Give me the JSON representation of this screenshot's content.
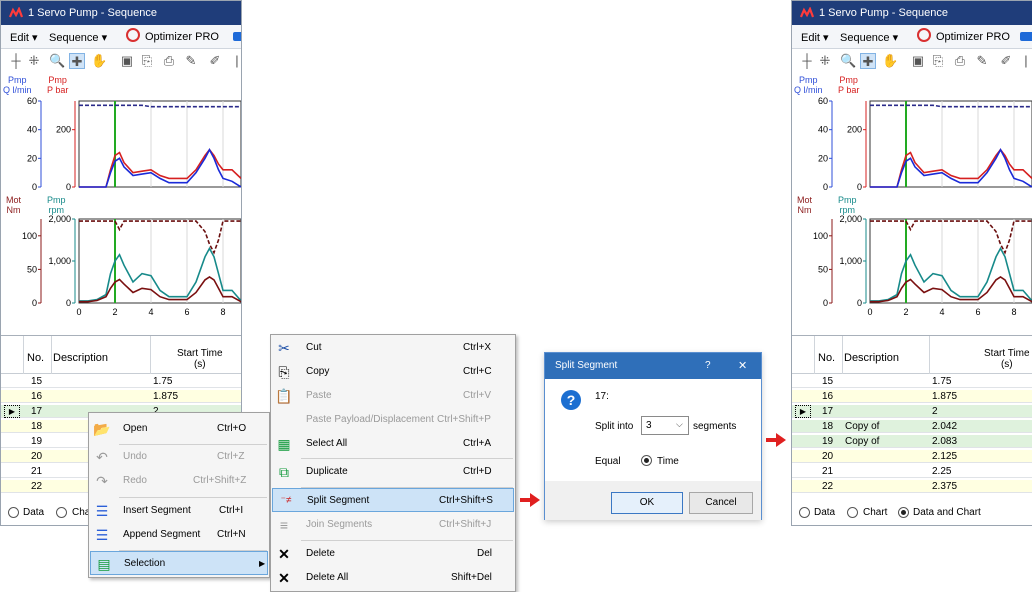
{
  "window": {
    "title": "1 Servo Pump - Sequence",
    "menu": {
      "edit": "Edit ▾",
      "sequence": "Sequence ▾",
      "optimizer": "Optimizer PRO"
    }
  },
  "chart_data": [
    {
      "type": "line",
      "title": "",
      "axes": [
        {
          "label": "Pmp\nQ l/min",
          "color": "#2f4fd8",
          "ticks": [
            "60",
            "40",
            "20",
            "0"
          ],
          "ylim": [
            0,
            60
          ]
        },
        {
          "label": "Pmp\nP bar",
          "color": "#d62020",
          "ticks": [
            "200",
            "0"
          ],
          "ylim": [
            0,
            300
          ]
        }
      ],
      "x": [
        0,
        0.5,
        1.0,
        1.5,
        1.75,
        2.0,
        2.25,
        2.5,
        3.0,
        3.5,
        4.0,
        4.5,
        5.0,
        5.5,
        6.0,
        6.5,
        7.0,
        7.25,
        7.5,
        7.75,
        8.0,
        8.5,
        9.0
      ],
      "xlim": [
        0,
        9
      ],
      "series": [
        {
          "color": "#2a2a8a",
          "style": "dash",
          "axis": 0,
          "values": [
            57,
            57,
            57,
            57,
            57,
            57,
            57,
            57,
            57,
            57,
            56,
            56,
            56,
            56,
            56,
            56,
            56,
            56,
            56,
            56,
            56,
            56,
            56
          ]
        },
        {
          "color": "#d62020",
          "style": "solid",
          "axis": 1,
          "values": [
            0,
            0,
            0,
            0,
            60,
            110,
            120,
            85,
            50,
            55,
            60,
            40,
            30,
            30,
            30,
            60,
            110,
            130,
            110,
            80,
            60,
            60,
            30
          ]
        },
        {
          "color": "#1a2ad8",
          "style": "solid",
          "axis": 1,
          "values": [
            0,
            0,
            0,
            0,
            50,
            90,
            100,
            70,
            40,
            45,
            50,
            30,
            15,
            15,
            15,
            50,
            100,
            130,
            100,
            60,
            30,
            20,
            0
          ]
        }
      ],
      "markers": [
        {
          "x": 2.0,
          "color": "#22aa22"
        }
      ]
    },
    {
      "type": "line",
      "title": "",
      "axes": [
        {
          "label": "Mot\nNm",
          "color": "#8b1a1a",
          "ticks": [
            "100",
            "50",
            "0"
          ],
          "ylim": [
            0,
            125
          ]
        },
        {
          "label": "Pmp\nrpm",
          "color": "#178a8a",
          "ticks": [
            "2,000",
            "1,000",
            "0"
          ],
          "ylim": [
            0,
            2000
          ]
        }
      ],
      "x": [
        0,
        0.5,
        1.0,
        1.5,
        1.75,
        2.0,
        2.25,
        2.5,
        3.0,
        3.5,
        4.0,
        4.5,
        5.0,
        5.5,
        6.0,
        6.5,
        7.0,
        7.25,
        7.5,
        7.75,
        8.0,
        8.5,
        9.0
      ],
      "xticks": [
        "0",
        "2",
        "4",
        "6",
        "8"
      ],
      "xlim": [
        0,
        9
      ],
      "series": [
        {
          "color": "#6a0f0f",
          "style": "dash",
          "axis": 1,
          "values": [
            1950,
            1950,
            1950,
            1950,
            1950,
            1950,
            1750,
            1950,
            1950,
            1950,
            1950,
            1950,
            1950,
            1950,
            1950,
            1950,
            1700,
            1400,
            1200,
            1500,
            1950,
            1950,
            1950
          ]
        },
        {
          "color": "#178a8a",
          "style": "solid",
          "axis": 1,
          "values": [
            50,
            50,
            80,
            200,
            700,
            1000,
            1150,
            900,
            500,
            700,
            650,
            300,
            150,
            150,
            150,
            500,
            1100,
            1300,
            1100,
            700,
            300,
            300,
            50
          ]
        },
        {
          "color": "#7a1010",
          "style": "solid",
          "axis": 1,
          "values": [
            30,
            30,
            60,
            150,
            350,
            500,
            560,
            450,
            250,
            350,
            320,
            150,
            80,
            80,
            80,
            250,
            550,
            620,
            550,
            350,
            150,
            150,
            30
          ]
        }
      ],
      "markers": [
        {
          "x": 2.0,
          "color": "#22aa22"
        }
      ]
    }
  ],
  "table": {
    "col_no": "No.",
    "col_desc": "Description",
    "col_start": "Start Time\n(s)"
  },
  "left_rows": [
    {
      "no": "15",
      "desc": "",
      "start": "1.75",
      "bg": "#ffffff"
    },
    {
      "no": "16",
      "desc": "",
      "start": "1.875",
      "bg": "#ffffe1"
    },
    {
      "no": "17",
      "desc": "",
      "start": "2",
      "bg": "#dff2dd",
      "current": true
    },
    {
      "no": "18",
      "desc": "",
      "start": "",
      "bg": "#ffffe1"
    },
    {
      "no": "19",
      "desc": "",
      "start": "",
      "bg": "#ffffff"
    },
    {
      "no": "20",
      "desc": "",
      "start": "",
      "bg": "#ffffe1"
    },
    {
      "no": "21",
      "desc": "",
      "start": "",
      "bg": "#ffffff"
    },
    {
      "no": "22",
      "desc": "",
      "start": "",
      "bg": "#ffffe1"
    }
  ],
  "right_rows": [
    {
      "no": "15",
      "desc": "",
      "start": "1.75",
      "bg": "#ffffff"
    },
    {
      "no": "16",
      "desc": "",
      "start": "1.875",
      "bg": "#ffffe1"
    },
    {
      "no": "17",
      "desc": "",
      "start": "2",
      "bg": "#dff2dd",
      "current": true
    },
    {
      "no": "18",
      "desc": "Copy of",
      "start": "2.042",
      "bg": "#dff2dd"
    },
    {
      "no": "19",
      "desc": "Copy of",
      "start": "2.083",
      "bg": "#dff2dd"
    },
    {
      "no": "20",
      "desc": "",
      "start": "2.125",
      "bg": "#ffffe1"
    },
    {
      "no": "21",
      "desc": "",
      "start": "2.25",
      "bg": "#ffffff"
    },
    {
      "no": "22",
      "desc": "",
      "start": "2.375",
      "bg": "#ffffe1"
    }
  ],
  "view": {
    "data": "Data",
    "chart": "Chart",
    "data_and_chart": "Data and Chart",
    "left_chart_partial": "Char"
  },
  "context_menu": {
    "items": [
      {
        "label": "Open",
        "shortcut": "Ctrl+O",
        "icon": "folder-icon",
        "glyph": "📂",
        "disabled": false
      },
      {
        "label": "Undo",
        "shortcut": "Ctrl+Z",
        "icon": "undo-icon",
        "glyph": "↶",
        "disabled": true
      },
      {
        "label": "Redo",
        "shortcut": "Ctrl+Shift+Z",
        "icon": "redo-icon",
        "glyph": "↷",
        "disabled": true
      },
      {
        "label": "Insert Segment",
        "shortcut": "Ctrl+I",
        "icon": "insert-segment-icon",
        "glyph": "☰",
        "disabled": false
      },
      {
        "label": "Append Segment",
        "shortcut": "Ctrl+N",
        "icon": "append-segment-icon",
        "glyph": "☰",
        "disabled": false
      },
      {
        "label": "Selection",
        "shortcut": "",
        "icon": "selection-icon",
        "glyph": "▤",
        "disabled": false,
        "submenu": true
      }
    ]
  },
  "submenu": {
    "items": [
      {
        "label": "Cut",
        "shortcut": "Ctrl+X",
        "icon": "scissors-icon",
        "glyph": "✂",
        "disabled": false
      },
      {
        "label": "Copy",
        "shortcut": "Ctrl+C",
        "icon": "copy-icon",
        "glyph": "⎘",
        "disabled": false
      },
      {
        "label": "Paste",
        "shortcut": "Ctrl+V",
        "icon": "paste-icon",
        "glyph": "📋",
        "disabled": true
      },
      {
        "label": "Paste Payload/Displacement",
        "shortcut": "Ctrl+Shift+P",
        "icon": "",
        "glyph": "",
        "disabled": true
      },
      {
        "label": "Select All",
        "shortcut": "Ctrl+A",
        "icon": "select-all-icon",
        "glyph": "▦",
        "disabled": false
      },
      {
        "label": "Duplicate",
        "shortcut": "Ctrl+D",
        "icon": "duplicate-icon",
        "glyph": "⧉",
        "disabled": false
      },
      {
        "label": "Split Segment",
        "shortcut": "Ctrl+Shift+S",
        "icon": "split-segment-icon",
        "glyph": "⁻≠",
        "disabled": false
      },
      {
        "label": "Join Segments",
        "shortcut": "Ctrl+Shift+J",
        "icon": "join-segments-icon",
        "glyph": "≡",
        "disabled": true
      },
      {
        "label": "Delete",
        "shortcut": "Del",
        "icon": "delete-icon",
        "glyph": "✕",
        "disabled": false
      },
      {
        "label": "Delete All",
        "shortcut": "Shift+Del",
        "icon": "delete-all-icon",
        "glyph": "✕",
        "disabled": false
      }
    ]
  },
  "dialog": {
    "title": "Split Segment",
    "help": "?",
    "close": "✕",
    "segment": "17:",
    "split_into_label": "Split into",
    "split_value": "3",
    "segments_label": "segments",
    "equal_label": "Equal",
    "time_label": "Time",
    "ok": "OK",
    "cancel": "Cancel"
  }
}
